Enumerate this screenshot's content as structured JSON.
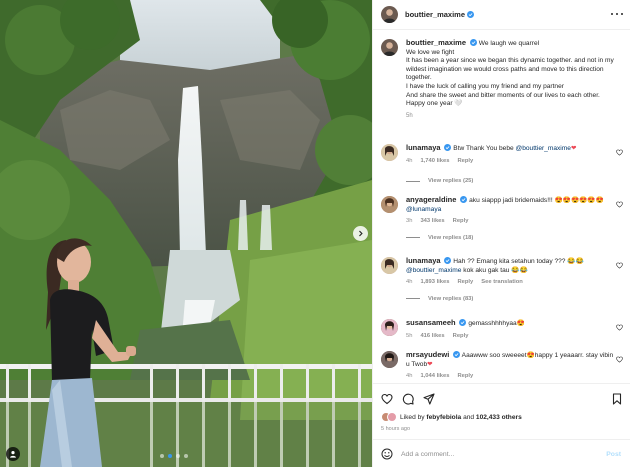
{
  "post": {
    "author": "bouttier_maxime",
    "caption": {
      "author": "bouttier_maxime",
      "first_line": "We laugh we quarrel",
      "lines": [
        "We love we fight",
        "It has been a year since we began this dynamic together. and not in my wildest imagination we would cross paths and move to this direction together.",
        "I have the luck of calling you my friend and my partner",
        "And share the sweet and bitter moments of our lives to each other.",
        "Happy one year 🤍"
      ],
      "time": "5h"
    },
    "comments": [
      {
        "user": "lunamaya",
        "text": "Btw Thank You bebe ",
        "mention": "@bouttier_maxime",
        "suffix": "❤",
        "time": "4h",
        "likes": "1,740 likes",
        "reply": "Reply",
        "translation": "",
        "view_replies": "View replies (25)"
      },
      {
        "user": "anyageraldine",
        "text": "aku siappp jadi bridemaids!!! 😍😍😍😍😍😍",
        "mention": "@lunamaya",
        "suffix": "",
        "time": "3h",
        "likes": "343 likes",
        "reply": "Reply",
        "translation": "",
        "view_replies": "View replies (18)"
      },
      {
        "user": "lunamaya",
        "text": "Hah ?? Emang kita setahun today ??? 😂😂",
        "mention": "@bouttier_maxime",
        "suffix": " kok aku gak tau 😂😂",
        "time": "4h",
        "likes": "1,893 likes",
        "reply": "Reply",
        "translation": "See translation",
        "view_replies": "View replies (83)"
      },
      {
        "user": "susansameeh",
        "text": "gemasshhhhyaa😍",
        "mention": "",
        "suffix": "",
        "time": "5h",
        "likes": "416 likes",
        "reply": "Reply",
        "translation": "",
        "view_replies": ""
      },
      {
        "user": "mrsayudewi",
        "text": "Aaawww soo sweeeet😍happy 1 yeaaarr. stay vibin u Twob",
        "mention": "",
        "suffix": "❤",
        "time": "4h",
        "likes": "1,044 likes",
        "reply": "Reply",
        "translation": "",
        "view_replies": ""
      }
    ],
    "liked_by_prefix": "Liked by ",
    "liked_by_user": "febyfebiola",
    "liked_by_and": "and",
    "likes_total": "102,433 others",
    "posted_ago": "5 hours ago",
    "add_comment_placeholder": "Add a comment...",
    "post_button": "Post"
  },
  "icons": {
    "header_more": "more-horizontal-icon",
    "verified": "verified-badge-icon",
    "like": "heart-icon",
    "comment": "comment-bubble-icon",
    "share": "paper-plane-icon",
    "save": "bookmark-icon",
    "emoji": "smiley-icon",
    "next": "chevron-right-icon",
    "tag": "person-tag-icon"
  },
  "colors": {
    "verified": "#3897f0",
    "link": "#00376b",
    "muted": "#8e8e8e",
    "post_button_disabled": "#b2dffc"
  },
  "carousel": {
    "slides": 4,
    "active": 1
  }
}
